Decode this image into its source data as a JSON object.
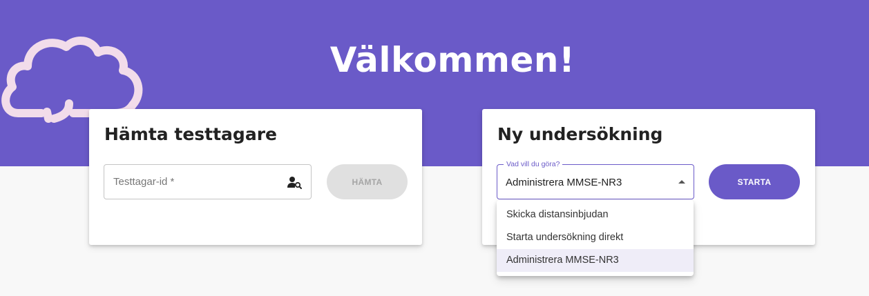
{
  "header": {
    "welcome": "Välkommen!"
  },
  "fetch_card": {
    "title": "Hämta testtagare",
    "input_placeholder": "Testtagar-id *",
    "button_label": "HÄMTA",
    "icon": "person-search-icon"
  },
  "new_exam_card": {
    "title": "Ny undersökning",
    "select_label": "Vad vill du göra?",
    "select_value": "Administrera MMSE-NR3",
    "button_label": "STARTA",
    "options": [
      {
        "label": "Skicka distansinbjudan"
      },
      {
        "label": "Starta undersökning direkt"
      },
      {
        "label": "Administrera MMSE-NR3",
        "selected": true
      }
    ]
  },
  "colors": {
    "brand": "#6a5ac8",
    "cloud": "#f2dcea",
    "disabled_button": "#e0e0e0"
  }
}
